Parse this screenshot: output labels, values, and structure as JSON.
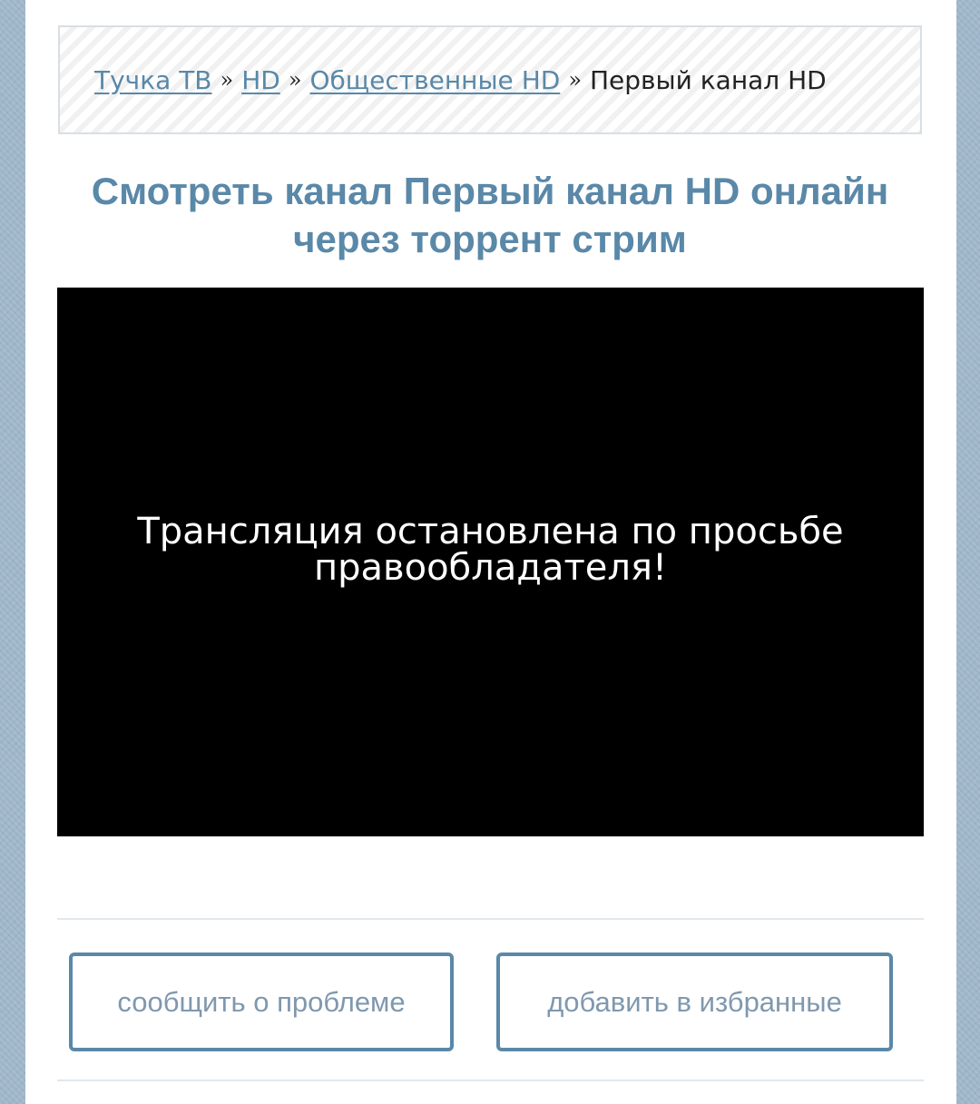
{
  "breadcrumb": {
    "items": [
      {
        "label": "Тучка ТВ"
      },
      {
        "label": "HD"
      },
      {
        "label": "Общественные HD"
      }
    ],
    "separator": "»",
    "current": "Первый канал HD"
  },
  "page": {
    "title": "Смотреть канал Первый канал HD онлайн через торрент стрим"
  },
  "player": {
    "message": "Трансляция остановлена по просьбе правообладателя!"
  },
  "actions": {
    "report_label": "сообщить о проблеме",
    "favorite_label": "добавить в избранные"
  },
  "colors": {
    "accent": "#5a88a8",
    "button_text": "#7f98ae",
    "background": "#9fb6c9",
    "player_bg": "#000000"
  }
}
